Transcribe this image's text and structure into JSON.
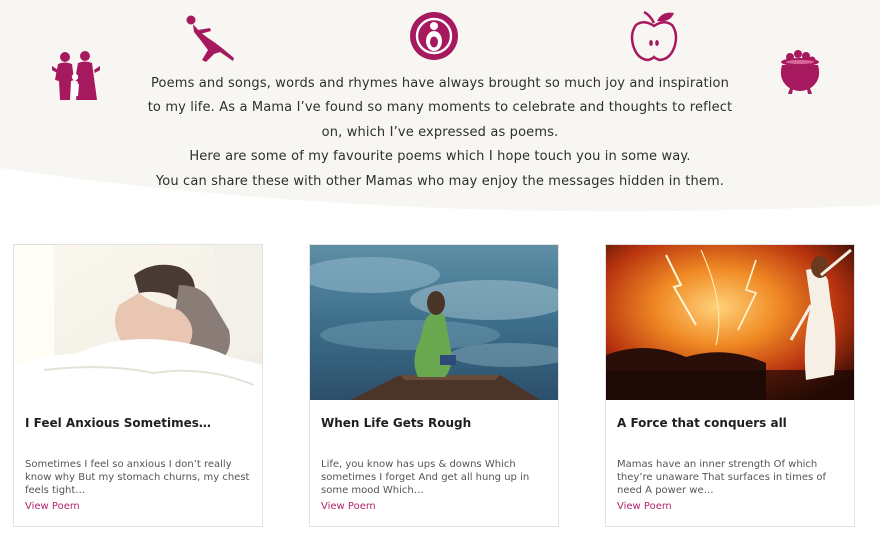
{
  "colors": {
    "brand": "#b3246c",
    "hero_bg": "#f8f6f2",
    "link": "#b3246c"
  },
  "hero": {
    "icons": [
      "family-icon",
      "yoga-pose-icon",
      "pregnancy-circle-icon",
      "apple-icon",
      "cauldron-icon"
    ],
    "intro_lines": [
      "Poems and songs, words and rhymes have always brought so much joy and inspiration",
      "to my life. As a Mama I’ve found so many moments to celebrate and thoughts to reflect",
      "on, which I’ve expressed as poems.",
      "Here are some of my favourite poems which I hope touch you in some way.",
      "You can share these with other Mamas who may enjoy the messages hidden in them."
    ]
  },
  "cards": [
    {
      "title": "I Feel Anxious Sometimes…",
      "excerpt": "Sometimes I feel so anxious I don’t really know why But my stomach churns, my chest feels tight…",
      "link": "View Poem",
      "image": "woman-hugging-knees-photo"
    },
    {
      "title": "When Life Gets Rough",
      "excerpt": "Life, you know has ups & downs Which sometimes I forget And get all hung up in some mood Which…",
      "link": "View Poem",
      "image": "girl-on-pier-lake-photo"
    },
    {
      "title": "A Force that conquers all",
      "excerpt": "Mamas have an inner strength Of which they’re unaware That surfaces in times of need A power we…",
      "link": "View Poem",
      "image": "woman-storm-lightning-photo"
    }
  ]
}
